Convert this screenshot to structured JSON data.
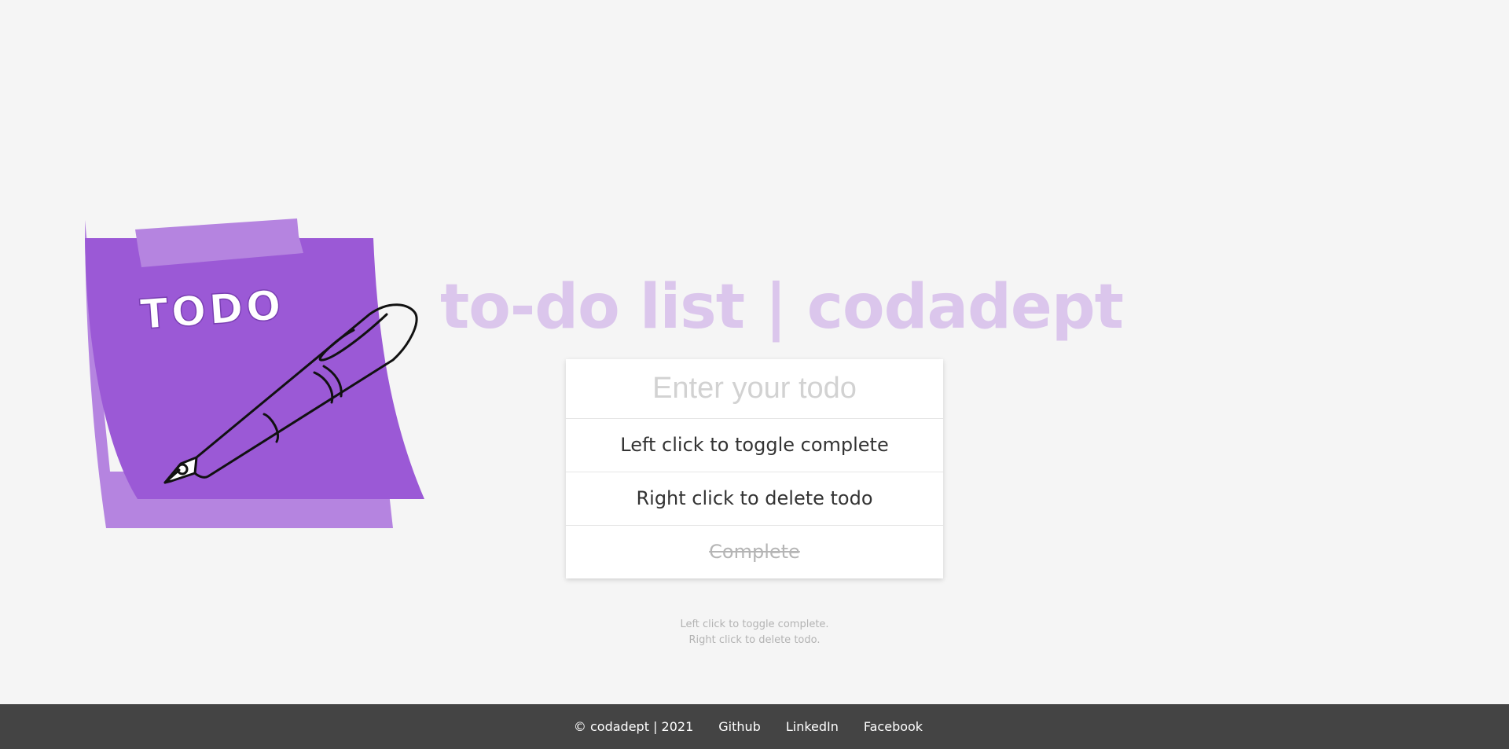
{
  "app": {
    "title": "to-do list | codadept"
  },
  "illustration": {
    "note_text": "TODO",
    "colors": {
      "note": "#9b59d6",
      "note_shadow": "#b584e0",
      "tape": "#b584e0"
    }
  },
  "todo": {
    "input_placeholder": "Enter your todo",
    "items": [
      {
        "text": "Left click to toggle complete",
        "completed": false
      },
      {
        "text": "Right click to delete todo",
        "completed": false
      },
      {
        "text": "Complete",
        "completed": true
      }
    ]
  },
  "help": {
    "line1": "Left click to toggle complete.",
    "line2": "Right click to delete todo."
  },
  "footer": {
    "copyright": "© codadept | 2021",
    "links": [
      "Github",
      "LinkedIn",
      "Facebook"
    ]
  },
  "colors": {
    "background": "#f5f5f5",
    "title": "#dbc6ec",
    "footer": "#444444"
  }
}
